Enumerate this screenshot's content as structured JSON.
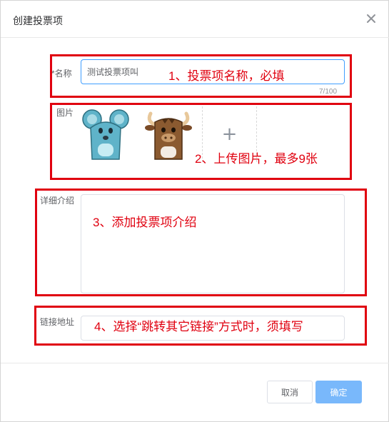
{
  "dialog": {
    "title": "创建投票项",
    "close_icon": "close-icon"
  },
  "form": {
    "name": {
      "label": "*名称",
      "value": "测试投票项叫",
      "counter": "7/100"
    },
    "images": {
      "label": "图片",
      "thumbnails": [
        "mouse-cartoon-image",
        "ox-cartoon-image"
      ],
      "upload_icon": "plus-icon",
      "upload_symbol": "+"
    },
    "description": {
      "label": "详细介绍",
      "value": ""
    },
    "link": {
      "label": "链接地址",
      "value": ""
    }
  },
  "annotations": [
    "1、投票项名称，必填",
    "2、上传图片，最多9张",
    "3、添加投票项介绍",
    "4、选择“跳转其它链接”方式时，须填写"
  ],
  "footer": {
    "cancel_label": "取消",
    "ok_label": "确定"
  },
  "colors": {
    "annotation": "#e0000f",
    "primary_disabled": "#79b8fb",
    "focus_border": "#409eff"
  }
}
